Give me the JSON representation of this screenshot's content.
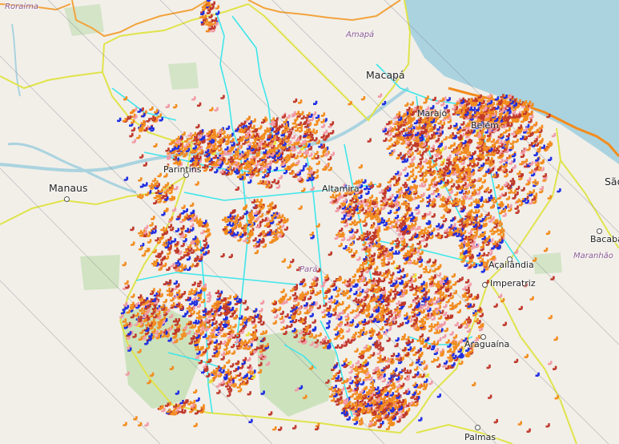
{
  "map": {
    "state_labels": {
      "roraima": "Roraima",
      "amapa": "Amapá",
      "para": "Pará",
      "maranhao": "Maranhão"
    },
    "city_labels": {
      "macapa": "Macapá",
      "parintins": "Parintins",
      "manaus": "Manaus",
      "altamira": "Altamira",
      "acailandia": "Açailândia",
      "imperatriz": "Imperatriz",
      "araguaina": "Araguaína",
      "bacabal": "Bacabal",
      "palmas": "Palmas",
      "marajo": "Marajó",
      "belem": "Belém",
      "sao_luis": "São"
    },
    "marker_colors": {
      "orange": "#f28c1e",
      "dark_red": "#c0392b",
      "blue": "#1f2fe0",
      "pink": "#f19aa6",
      "yellow": "#e8e33c"
    },
    "layer_colors": {
      "water": "#aad3df",
      "land": "#f2efe9",
      "forest": "#c8e0b8",
      "state_border": "#e0e34a",
      "municipal_border": "#3fe6ea",
      "international_border": "#f2a33c"
    }
  }
}
